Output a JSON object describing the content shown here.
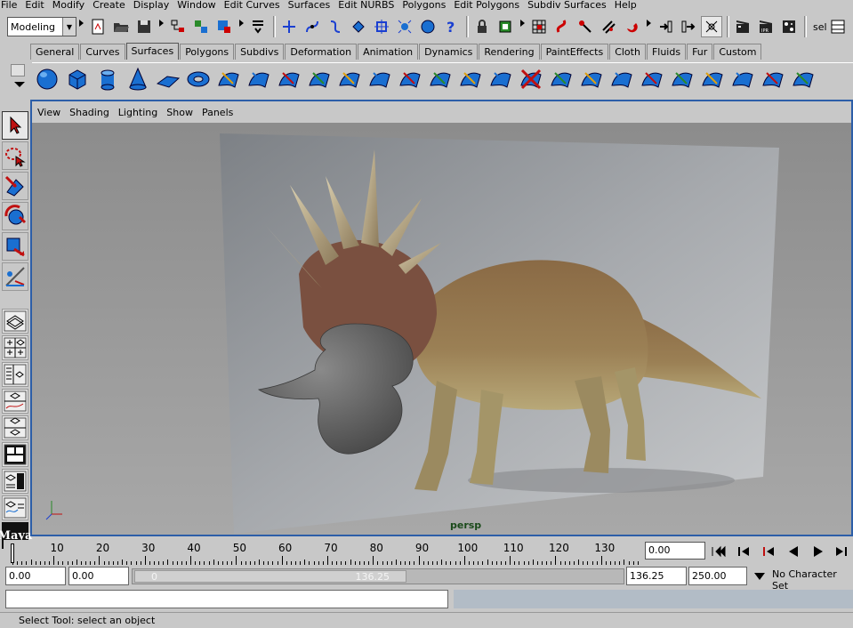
{
  "menubar": [
    "File",
    "Edit",
    "Modify",
    "Create",
    "Display",
    "Window",
    "Edit Curves",
    "Surfaces",
    "Edit NURBS",
    "Polygons",
    "Edit Polygons",
    "Subdiv Surfaces",
    "Help"
  ],
  "statusline": {
    "mode": "Modeling",
    "selection_field": "sel",
    "icons": [
      "new-scene-icon",
      "open-scene-icon",
      "save-scene-icon",
      "select-by-hierarchy-icon",
      "select-by-object-icon",
      "select-by-component-icon",
      "snap-to-grid-icon",
      "snap-to-curve-icon",
      "snap-to-point-icon",
      "snap-to-view-plane-icon",
      "make-live-icon",
      "history-icon",
      "render-icon",
      "ipr-render-icon",
      "render-globals-icon"
    ]
  },
  "shelf_tabs": [
    {
      "label": "General",
      "active": false
    },
    {
      "label": "Curves",
      "active": false
    },
    {
      "label": "Surfaces",
      "active": true
    },
    {
      "label": "Polygons",
      "active": false
    },
    {
      "label": "Subdivs",
      "active": false
    },
    {
      "label": "Deformation",
      "active": false
    },
    {
      "label": "Animation",
      "active": false
    },
    {
      "label": "Dynamics",
      "active": false
    },
    {
      "label": "Rendering",
      "active": false
    },
    {
      "label": "PaintEffects",
      "active": false
    },
    {
      "label": "Cloth",
      "active": false
    },
    {
      "label": "Fluids",
      "active": false
    },
    {
      "label": "Fur",
      "active": false
    },
    {
      "label": "Custom",
      "active": false
    }
  ],
  "shelf_icons": [
    "nurbs-sphere-icon",
    "nurbs-cube-icon",
    "nurbs-cylinder-icon",
    "nurbs-cone-icon",
    "nurbs-plane-icon",
    "nurbs-torus-icon",
    "revolve-icon",
    "loft-icon",
    "planar-icon",
    "extrude-icon",
    "birail-icon",
    "boundary-icon",
    "square-icon",
    "bevel-icon",
    "intersect-icon",
    "project-curve-icon",
    "trim-tool-icon",
    "untrim-icon",
    "attach-surfaces-icon",
    "detach-surfaces-icon",
    "align-surfaces-icon",
    "open-close-surfaces-icon",
    "insert-isoparm-icon",
    "extend-surfaces-icon",
    "rebuild-surfaces-icon",
    "sculpt-tool-icon"
  ],
  "toolbox": [
    "select-tool-icon",
    "lasso-tool-icon",
    "move-tool-icon",
    "rotate-tool-icon",
    "scale-tool-icon",
    "manipulator-tool-icon"
  ],
  "layouts": [
    "single-perspective-layout-icon",
    "four-view-layout-icon",
    "outliner-layout-icon",
    "graph-editor-layout-icon",
    "hypershade-layout-icon",
    "persp-graph-layout-icon",
    "persp-outliner-layout-icon",
    "script-editor-layout-icon"
  ],
  "logo": "Maya",
  "panel_menu": [
    "View",
    "Shading",
    "Lighting",
    "Show",
    "Panels"
  ],
  "viewport": {
    "camera_label": "persp"
  },
  "timeslider": {
    "ticks": [
      "10",
      "20",
      "30",
      "40",
      "50",
      "60",
      "70",
      "80",
      "90",
      "100",
      "110",
      "120",
      "130"
    ],
    "current_frame": "0.00",
    "playback_icons": [
      "go-to-start-icon",
      "step-back-frame-icon",
      "step-back-key-icon",
      "play-backwards-icon",
      "play-forwards-icon",
      "step-forward-key-icon"
    ]
  },
  "range": {
    "start_time": "0.00",
    "playback_start": "0.00",
    "slider_start": "0",
    "slider_end": "136.25",
    "playback_end": "136.25",
    "end_time": "250.00",
    "character_set": "No Character Set"
  },
  "helpline": "Select Tool: select an object",
  "colors": {
    "viewport_border": "#2c5ea8",
    "accent_blue": "#1a6fd1",
    "background": "#c8c8c8"
  }
}
